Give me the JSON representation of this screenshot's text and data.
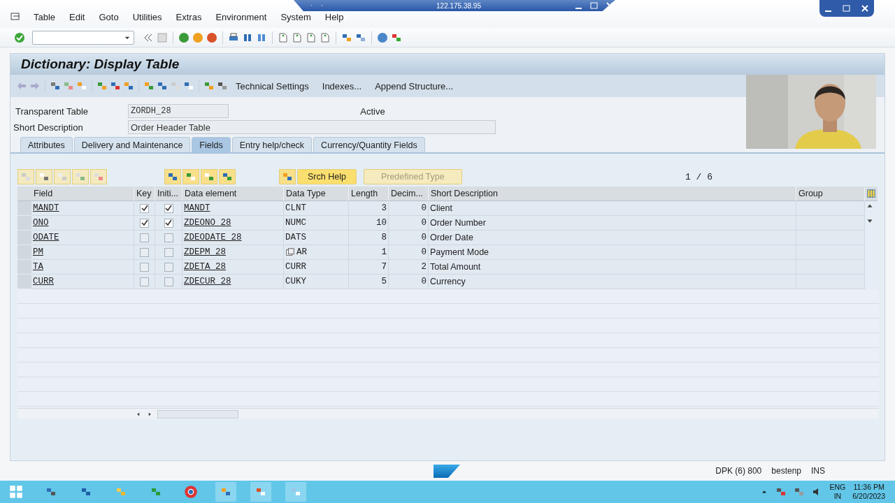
{
  "remote_bar": {
    "address": "122.175.38.95"
  },
  "menu": [
    "Table",
    "Edit",
    "Goto",
    "Utilities",
    "Extras",
    "Environment",
    "System",
    "Help"
  ],
  "title": "Dictionary: Display Table",
  "app_toolbar": [
    "Technical Settings",
    "Indexes...",
    "Append Structure..."
  ],
  "header": {
    "table_label": "Transparent Table",
    "table_name": "ZORDH_28",
    "table_status": "Active",
    "description_label": "Short Description",
    "description": "Order Header Table"
  },
  "tabs": [
    {
      "label": "Attributes",
      "selected": false
    },
    {
      "label": "Delivery and Maintenance",
      "selected": false
    },
    {
      "label": "Fields",
      "selected": true
    },
    {
      "label": "Entry help/check",
      "selected": false
    },
    {
      "label": "Currency/Quantity Fields",
      "selected": false
    }
  ],
  "table_toolbar": {
    "buttons": [
      {
        "label": "Srch Help",
        "disabled": false
      },
      {
        "label": "Predefined Type",
        "disabled": true
      }
    ],
    "page": "1 / 6"
  },
  "columns": [
    "Field",
    "Key",
    "Initi...",
    "Data element",
    "Data Type",
    "Length",
    "Decim...",
    "Short Description",
    "Group"
  ],
  "rows": [
    {
      "field": "MANDT",
      "key": true,
      "initial": true,
      "data_element": "MANDT",
      "data_type": "CLNT",
      "length": "3",
      "decimals": "0",
      "description": "Client"
    },
    {
      "field": "ONO",
      "key": true,
      "initial": true,
      "data_element": "ZDEONO_28",
      "data_type": "NUMC",
      "length": "10",
      "decimals": "0",
      "description": "Order Number"
    },
    {
      "field": "ODATE",
      "key": false,
      "initial": false,
      "data_element": "ZDEODATE_28",
      "data_type": "DATS",
      "length": "8",
      "decimals": "0",
      "description": "Order Date"
    },
    {
      "field": "PM",
      "key": false,
      "initial": false,
      "data_element": "ZDEPM_28",
      "data_type": "AR",
      "length": "1",
      "decimals": "0",
      "description": "Payment Mode"
    },
    {
      "field": "TA",
      "key": false,
      "initial": false,
      "data_element": "ZDETA_28",
      "data_type": "CURR",
      "length": "7",
      "decimals": "2",
      "description": "Total Amount"
    },
    {
      "field": "CURR",
      "key": false,
      "initial": false,
      "data_element": "ZDECUR_28",
      "data_type": "CUKY",
      "length": "5",
      "decimals": "0",
      "description": "Currency"
    }
  ],
  "status_bar": {
    "system": "DPK (6) 800",
    "server": "bestenp",
    "mode": "INS"
  },
  "taskbar": {
    "language": "ENG",
    "region": "IN",
    "time": "11:36 PM",
    "date": "6/20/2023"
  }
}
